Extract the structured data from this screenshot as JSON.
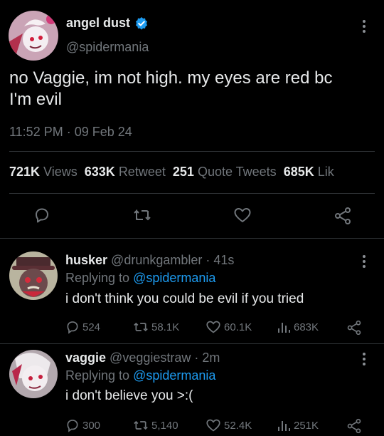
{
  "tweet": {
    "display_name": "angel dust",
    "handle": "@spidermania",
    "text_line1": "no Vaggie, im not high. my eyes are red bc",
    "text_line2": "I'm evil",
    "timestamp": "11:52 PM · 09 Feb 24",
    "stats": {
      "views_count": "721K",
      "views_label": "Views",
      "retweets_count": "633K",
      "retweets_label": "Retweet",
      "quotes_count": "251",
      "quotes_label": "Quote Tweets",
      "likes_count": "685K",
      "likes_label": "Lik"
    }
  },
  "replies": [
    {
      "display_name": "husker",
      "handle_time": "@drunkgambler · 41s",
      "replying_prefix": "Replying to",
      "replying_to": "@spidermania",
      "text": "i don't think you could be evil if you tried",
      "replies": "524",
      "retweets": "58.1K",
      "likes": "60.1K",
      "views": "683K"
    },
    {
      "display_name": "vaggie",
      "handle_time": "@veggiestraw · 2m",
      "replying_prefix": "Replying to",
      "replying_to": "@spidermania",
      "text": "i don't believe you >:(",
      "replies": "300",
      "retweets": "5,140",
      "likes": "52.4K",
      "views": "251K"
    }
  ],
  "colors": {
    "accent": "#1d9bf0",
    "background": "#000000",
    "muted": "#71767b"
  }
}
